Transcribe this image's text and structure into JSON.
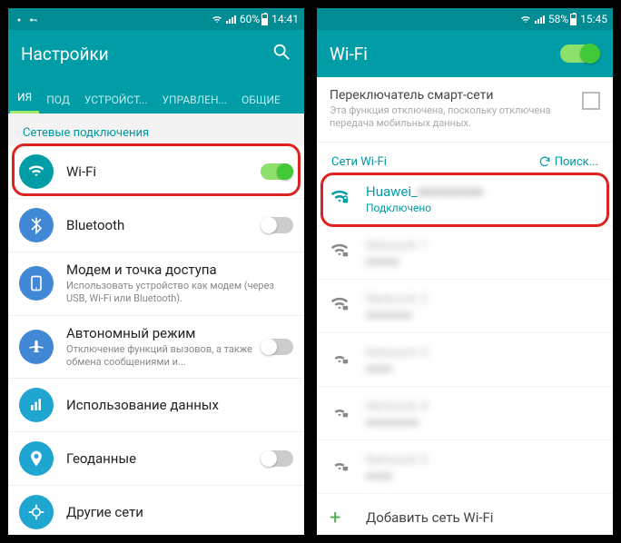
{
  "left": {
    "status": {
      "battery_pct": "60%",
      "time": "14:41"
    },
    "appbar": {
      "title": "Настройки"
    },
    "tabs": [
      "ИЯ",
      "ПОД",
      "УСТРОЙСТ...",
      "УПРАВЛЕН...",
      "ОБЩИЕ"
    ],
    "section_label": "Сетевые подключения",
    "rows": {
      "wifi": {
        "label": "Wi-Fi"
      },
      "bluetooth": {
        "label": "Bluetooth"
      },
      "tether": {
        "label": "Модем и точка доступа",
        "sub": "Использовать устройство как модем (через USB, Wi-Fi или Bluetooth)."
      },
      "airplane": {
        "label": "Автономный режим",
        "sub": "Отключение функций вызовов, а также обмена сообщениями и..."
      },
      "data": {
        "label": "Использование данных"
      },
      "geo": {
        "label": "Геоданные"
      },
      "more": {
        "label": "Другие сети"
      }
    }
  },
  "right": {
    "status": {
      "battery_pct": "58%",
      "time": "15:45"
    },
    "appbar": {
      "title": "Wi-Fi"
    },
    "smart": {
      "title": "Переключатель смарт-сети",
      "sub": "Эта функция отключена, поскольку отключена передача мобильных данных."
    },
    "net_label": "Сети Wi-Fi",
    "scan_label": "Поиск...",
    "connected": {
      "ssid": "Huawei_",
      "status": "Подключено"
    },
    "others": [
      "Network 1",
      "Network 2",
      "Network 3",
      "Network 4",
      "Network 5"
    ],
    "add_label": "Добавить сеть Wi-Fi"
  }
}
